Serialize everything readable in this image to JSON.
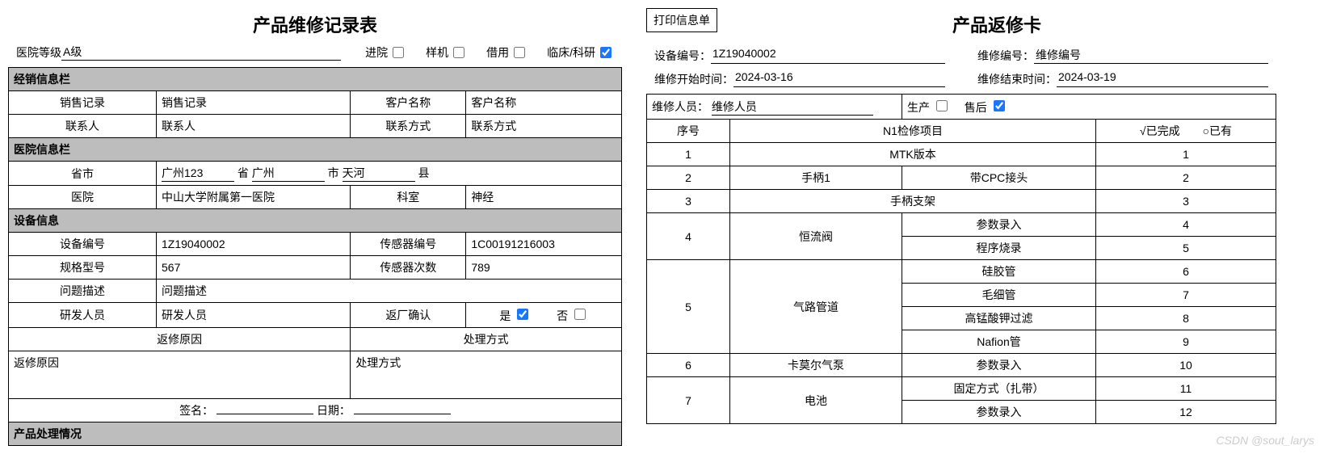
{
  "left": {
    "title": "产品维修记录表",
    "hospital_level_label": "医院等级",
    "hospital_level_value": "A级",
    "ck_enter_label": "进院",
    "ck_proto_label": "样机",
    "ck_borrow_label": "借用",
    "ck_clinical_label": "临床/科研",
    "ck_clinical_checked": true,
    "sec_dealer": "经销信息栏",
    "lbl_sales_record": "销售记录",
    "val_sales_record": "销售记录",
    "lbl_customer": "客户名称",
    "val_customer": "客户名称",
    "lbl_contact": "联系人",
    "val_contact": "联系人",
    "lbl_contact_way": "联系方式",
    "val_contact_way": "联系方式",
    "sec_hospital": "医院信息栏",
    "lbl_region": "省市",
    "region_code": "广州123",
    "region_prov_lbl": "省",
    "region_prov": "广州",
    "region_city_lbl": "市",
    "region_city": "天河",
    "region_county_lbl": "县",
    "lbl_hospital": "医院",
    "val_hospital": "中山大学附属第一医院",
    "lbl_department": "科室",
    "val_department": "神经",
    "sec_device": "设备信息",
    "lbl_device_no": "设备编号",
    "val_device_no": "1Z19040002",
    "lbl_sensor_no": "传感器编号",
    "val_sensor_no": "1C00191216003",
    "lbl_spec": "规格型号",
    "val_spec": "567",
    "lbl_sensor_count": "传感器次数",
    "val_sensor_count": "789",
    "lbl_problem": "问题描述",
    "val_problem": "问题描述",
    "lbl_rd": "研发人员",
    "val_rd": "研发人员",
    "lbl_return_confirm": "返厂确认",
    "yes": "是",
    "no": "否",
    "lbl_return_reason": "返修原因",
    "lbl_handle_way": "处理方式",
    "val_return_reason": "返修原因",
    "val_handle_way": "处理方式",
    "sign_label": "签名：",
    "date_label": "日期：",
    "sec_product_handle": "产品处理情况"
  },
  "right": {
    "print_btn": "打印信息单",
    "title": "产品返修卡",
    "lbl_device_no": "设备编号：",
    "val_device_no": "1Z19040002",
    "lbl_repair_no": "维修编号：",
    "val_repair_no": "维修编号",
    "lbl_start": "维修开始时间：",
    "val_start": "2024-03-16",
    "lbl_end": "维修结束时间：",
    "val_end": "2024-03-19",
    "lbl_repair_person": "维修人员：",
    "val_repair_person": "维修人员",
    "lbl_produce": "生产",
    "lbl_after": "售后",
    "ck_after_checked": true,
    "hdr_seq": "序号",
    "hdr_project": "N1检修项目",
    "hdr_status": "√已完成　　○已有",
    "rows": [
      {
        "seq": "1",
        "g": "",
        "item": "MTK版本",
        "s": "1"
      },
      {
        "seq": "2",
        "g": "手柄1",
        "item": "带CPC接头",
        "s": "2"
      },
      {
        "seq": "3",
        "g": "手柄支架",
        "item": "",
        "s": "3"
      },
      {
        "seq": "4",
        "g": "恒流阀",
        "item": "参数录入",
        "s": "4",
        "rs": 2
      },
      {
        "seq": "",
        "g": "",
        "item": "程序烧录",
        "s": "5"
      },
      {
        "seq": "5",
        "g": "气路管道",
        "item": "硅胶管",
        "s": "6",
        "rs": 4
      },
      {
        "seq": "",
        "g": "",
        "item": "毛细管",
        "s": "7"
      },
      {
        "seq": "",
        "g": "",
        "item": "高锰酸钾过滤",
        "s": "8"
      },
      {
        "seq": "",
        "g": "",
        "item": "Nafion管",
        "s": "9"
      },
      {
        "seq": "6",
        "g": "卡莫尔气泵",
        "item": "参数录入",
        "s": "10"
      },
      {
        "seq": "7",
        "g": "电池",
        "item": "固定方式（扎带）",
        "s": "11",
        "rs": 2
      },
      {
        "seq": "",
        "g": "",
        "item": "参数录入",
        "s": "12"
      }
    ]
  },
  "watermark": "CSDN @sout_larys"
}
